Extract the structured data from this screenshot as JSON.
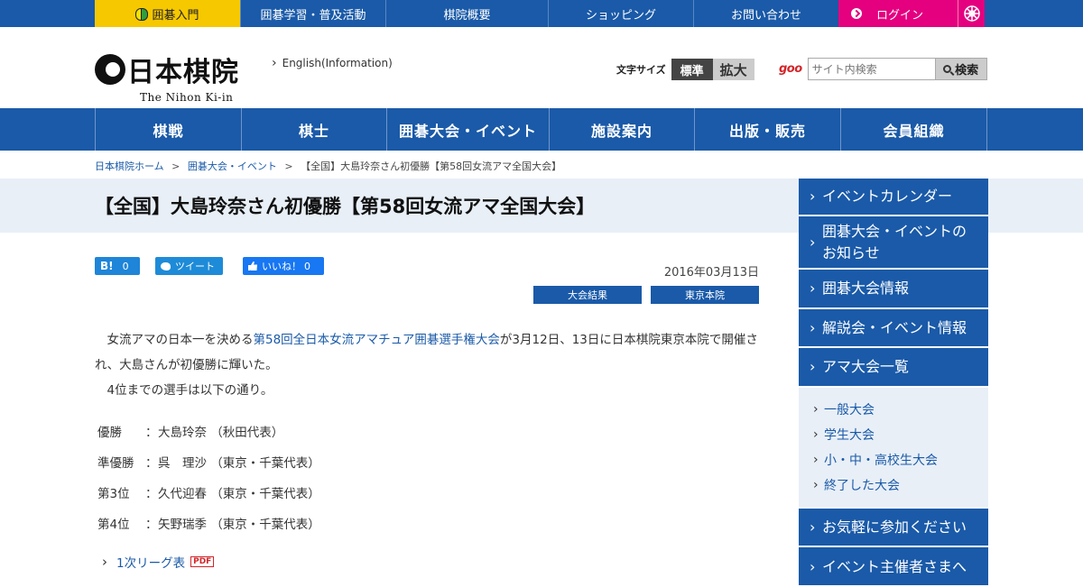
{
  "topbar": {
    "items": [
      "囲碁入門",
      "囲碁学習・普及活動",
      "棋院概要",
      "ショッピング",
      "お問い合わせ"
    ],
    "login": "ログイン"
  },
  "header": {
    "logo_jp": "日本棋院",
    "logo_en": "The Nihon Ki-in",
    "english_link": "English(Information)",
    "fontsize_label": "文字サイズ",
    "fontsize_standard": "標準",
    "fontsize_large": "拡大",
    "goo": "goo",
    "search_placeholder": "サイト内検索",
    "search_button": "検索"
  },
  "mainnav": [
    "棋戦",
    "棋士",
    "囲碁大会・イベント",
    "施設案内",
    "出版・販売",
    "会員組織"
  ],
  "breadcrumb": [
    "日本棋院ホーム",
    "囲碁大会・イベント",
    "【全国】大島玲奈さん初優勝【第58回女流アマ全国大会】"
  ],
  "page_title": "【全国】大島玲奈さん初優勝【第58回女流アマ全国大会】",
  "social": {
    "hatena_label": "B!",
    "hatena_count": "0",
    "tweet_label": "ツイート",
    "like_label": "いいね！",
    "like_count": "0"
  },
  "date": "2016年03月13日",
  "tags": [
    "大会結果",
    "東京本院"
  ],
  "body": {
    "p1_pre": "女流アマの日本一を決める",
    "p1_link": "第58回全日本女流アマチュア囲碁選手権大会",
    "p1_post": "が3月12日、13日に日本棋院東京本院で開催され、大島さんが初優勝に輝いた。",
    "p2": "4位までの選手は以下の通り。"
  },
  "results": [
    {
      "rank": "優勝",
      "name": "大島玲奈 （秋田代表）"
    },
    {
      "rank": "準優勝",
      "name": "呉　理沙 （東京・千葉代表）"
    },
    {
      "rank": "第3位",
      "name": "久代迎春 （東京・千葉代表）"
    },
    {
      "rank": "第4位",
      "name": "矢野瑞季 （東京・千葉代表）"
    }
  ],
  "colon": "：",
  "league_link": "1次リーグ表",
  "pdf_label": "PDF",
  "sidebar": {
    "top": [
      "イベントカレンダー",
      "囲碁大会・イベントのお知らせ",
      "囲碁大会情報",
      "解説会・イベント情報",
      "アマ大会一覧"
    ],
    "sub": [
      "一般大会",
      "学生大会",
      "小・中・高校生大会",
      "終了した大会"
    ],
    "bottom": [
      "お気軽に参加ください",
      "イベント主催者さまへ"
    ]
  },
  "colors": {
    "primary": "#1a5aa8",
    "login": "#e4007f",
    "beginner": "#f6c800",
    "band": "#e8eff7"
  }
}
